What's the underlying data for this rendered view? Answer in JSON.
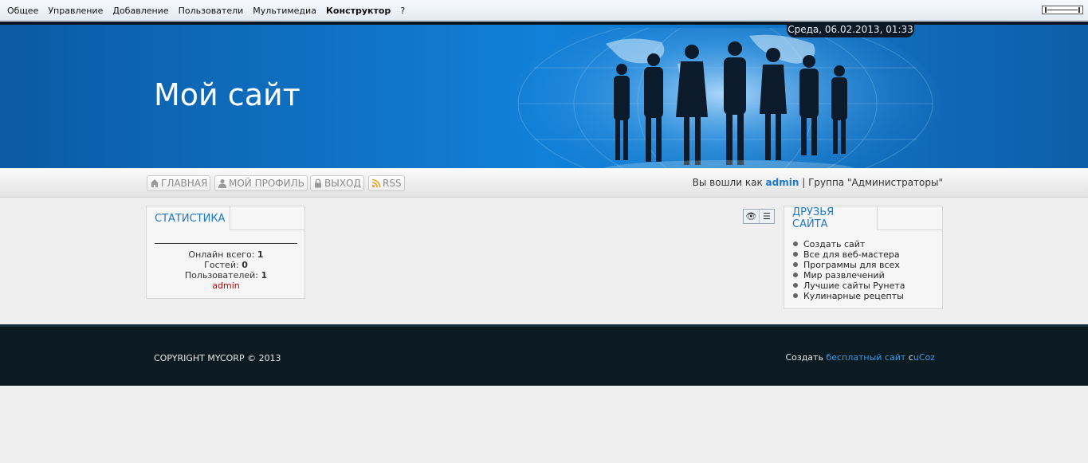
{
  "admin_menu": {
    "items": [
      "Общее",
      "Управление",
      "Добавление",
      "Пользователи",
      "Мультимедиа",
      "Конструктор",
      "?"
    ],
    "active": "Конструктор"
  },
  "header": {
    "date": "Среда, 06.02.2013, 01:33",
    "site_title": "Мой сайт"
  },
  "nav": {
    "buttons": [
      {
        "label": "ГЛАВНАЯ",
        "icon": "home-icon"
      },
      {
        "label": "МОЙ ПРОФИЛЬ",
        "icon": "user-icon"
      },
      {
        "label": "ВЫХОД",
        "icon": "lock-icon"
      },
      {
        "label": "RSS",
        "icon": "rss-icon"
      }
    ],
    "logged_in_prefix": "Вы вошли как",
    "username": "admin",
    "group_text": "| Группа \"Администраторы\""
  },
  "stats": {
    "title": "Статистика",
    "online_label": "Онлайн всего:",
    "online_value": "1",
    "guests_label": "Гостей:",
    "guests_value": "0",
    "users_label": "Пользователей:",
    "users_value": "1",
    "user_link": "admin"
  },
  "friends": {
    "title": "Друзья сайта",
    "items": [
      "Создать сайт",
      "Все для веб-мастера",
      "Программы для всех",
      "Мир развлечений",
      "Лучшие сайты Рунета",
      "Кулинарные рецепты"
    ]
  },
  "footer": {
    "copyright": "COPYRIGHT MYCORP © 2013",
    "made_prefix": "Создать",
    "made_link": "бесплатный сайт",
    "made_middle": "с",
    "made_brand": "uCoz"
  },
  "colors": {
    "header_blue": "#1180d8",
    "link_blue": "#1e78c8",
    "footer_dark": "#0c1a22",
    "admin_red": "#cc0000"
  }
}
